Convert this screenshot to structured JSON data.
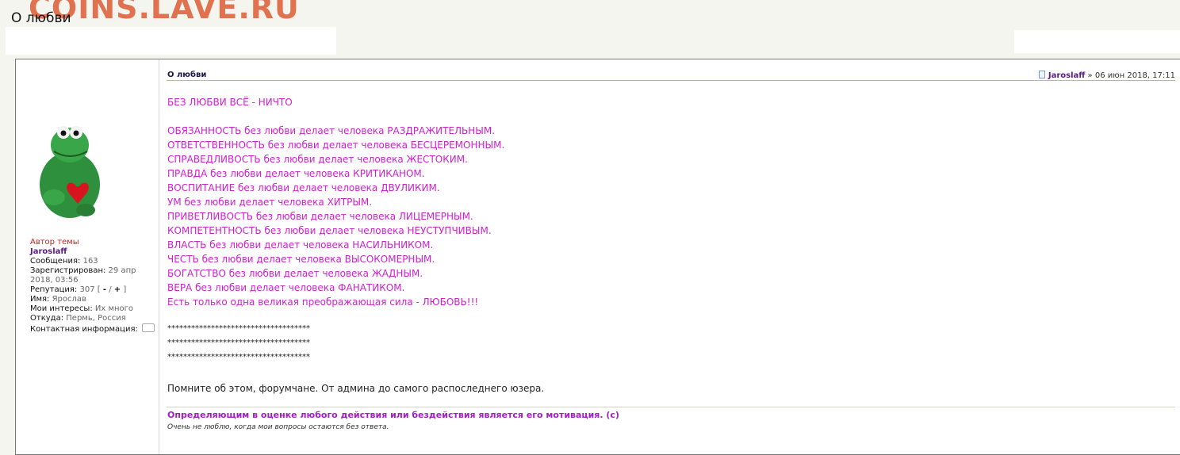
{
  "watermark": "COINS.LAVE.RU",
  "page_title": "О любви",
  "author": {
    "role": "Автор темы",
    "name": "Jaroslaff",
    "posts_label": "Сообщения:",
    "posts_value": "163",
    "registered_label": "Зарегистрирован:",
    "registered_value": "29 апр 2018, 03:56",
    "reputation_label": "Репутация:",
    "reputation_value": "307",
    "rep_open": "[",
    "rep_minus": "-",
    "rep_sep": "/",
    "rep_plus": "+",
    "rep_close": "]",
    "name_label": "Имя:",
    "name_value": "Ярослав",
    "interests_label": "Мои интересы:",
    "interests_value": "Их много",
    "from_label": "Откуда:",
    "from_value": "Пермь, Россия",
    "contact_label": "Контактная информация:"
  },
  "post": {
    "subject": "О любви",
    "meta_author": "Jaroslaff",
    "meta_sep": " » ",
    "meta_date": "06 июн 2018, 17:11",
    "heading": "БЕЗ ЛЮБВИ ВСЁ - НИЧТО",
    "lines": [
      "ОБЯЗАННОСТЬ без любви делает человека РАЗДРАЖИТЕЛЬНЫМ.",
      "ОТВЕТСТВЕННОСТЬ без любви делает человека БЕСЦЕРЕМОННЫМ.",
      "СПРАВЕДЛИВОСТЬ без любви делает человека ЖЕСТОКИМ.",
      "ПРАВДА без любви делает человека КРИТИКАНОМ.",
      "ВОСПИТАНИЕ без любви делает человека ДВУЛИКИМ.",
      "УМ без любви делает человека ХИТРЫМ.",
      "ПРИВЕТЛИВОСТЬ без любви делает человека ЛИЦЕМЕРНЫМ.",
      "КОМПЕТЕНТНОСТЬ без любви делает человека НЕУСТУПЧИВЫМ.",
      "ВЛАСТЬ без любви делает человека НАСИЛЬНИКОМ.",
      "ЧЕСТЬ без любви делает человека ВЫСОКОМЕРНЫМ.",
      "БОГАТСТВО без любви делает человека ЖАДНЫМ.",
      "ВЕРА без любви делает человека ФАНАТИКОМ.",
      "Есть только одна великая преображающая сила - ЛЮБОВЬ!!!"
    ],
    "stars": [
      "************************************",
      "************************************",
      "************************************"
    ],
    "closing": "Помните об этом, форумчане. От админа до самого распоследнего юзера."
  },
  "signature": {
    "quote": "Определяющим в оценке любого действия или бездействия является его мотивация. (с)",
    "note": "Очень не люблю, когда мои вопросы остаются без ответа."
  },
  "colors": {
    "accent_magenta": "#cc22cc",
    "author_name": "#5a1a8a",
    "author_role": "#cc2222",
    "watermark": "#e0724f"
  }
}
